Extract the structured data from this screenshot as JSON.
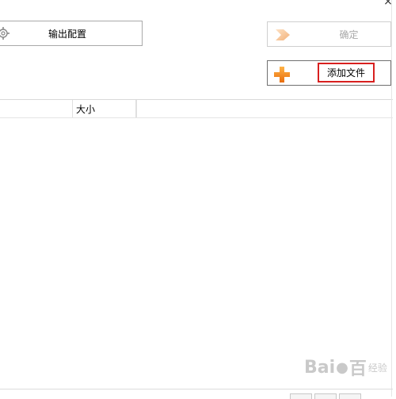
{
  "window": {
    "close_glyph": "×"
  },
  "toolbar": {
    "output_config_label": "输出配置",
    "confirm_label": "确定",
    "add_file_label": "添加文件"
  },
  "table": {
    "columns": [
      "",
      "大小",
      ""
    ],
    "rows": []
  },
  "watermark": {
    "brand": "Bai",
    "brand2": "百",
    "suffix": "经验"
  },
  "colors": {
    "accent_orange": "#f08a1c",
    "highlight_red": "#d8201f"
  }
}
